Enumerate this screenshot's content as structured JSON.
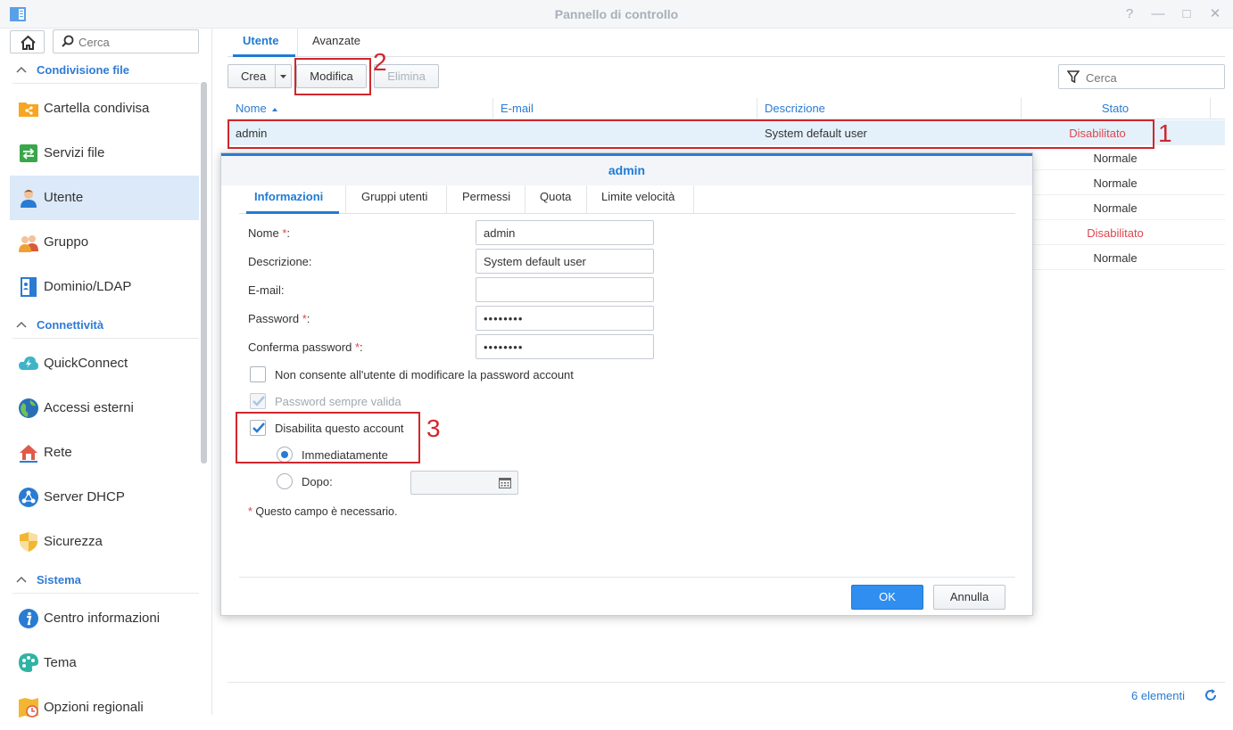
{
  "window": {
    "title": "Pannello di controllo"
  },
  "sidebar": {
    "search_placeholder": "Cerca",
    "sections": [
      {
        "label": "Condivisione file"
      },
      {
        "label": "Connettività"
      },
      {
        "label": "Sistema"
      }
    ],
    "items": [
      {
        "label": "Cartella condivisa",
        "icon": "shared-folder-icon"
      },
      {
        "label": "Servizi file",
        "icon": "file-services-icon"
      },
      {
        "label": "Utente",
        "icon": "user-icon"
      },
      {
        "label": "Gruppo",
        "icon": "group-icon"
      },
      {
        "label": "Dominio/LDAP",
        "icon": "domain-ldap-icon"
      },
      {
        "label": "QuickConnect",
        "icon": "quickconnect-icon"
      },
      {
        "label": "Accessi esterni",
        "icon": "external-access-icon"
      },
      {
        "label": "Rete",
        "icon": "network-icon"
      },
      {
        "label": "Server DHCP",
        "icon": "dhcp-server-icon"
      },
      {
        "label": "Sicurezza",
        "icon": "security-icon"
      },
      {
        "label": "Centro informazioni",
        "icon": "info-center-icon"
      },
      {
        "label": "Tema",
        "icon": "theme-icon"
      },
      {
        "label": "Opzioni regionali",
        "icon": "regional-options-icon"
      }
    ]
  },
  "main": {
    "tabs": [
      {
        "label": "Utente"
      },
      {
        "label": "Avanzate"
      }
    ],
    "toolbar": {
      "create": "Crea",
      "edit": "Modifica",
      "delete": "Elimina",
      "filter_placeholder": "Cerca"
    },
    "columns": [
      "Nome",
      "E-mail",
      "Descrizione",
      "Stato"
    ],
    "rows": [
      {
        "name": "admin",
        "email": "",
        "description": "System default user",
        "status": "Disabilitato"
      },
      {
        "status": "Normale"
      },
      {
        "status": "Normale"
      },
      {
        "status": "Normale"
      },
      {
        "status": "Disabilitato"
      },
      {
        "status": "Normale"
      }
    ],
    "footer": {
      "count": "6 elementi"
    }
  },
  "annotations": [
    "1",
    "2",
    "3"
  ],
  "dialog": {
    "title": "admin",
    "tabs": [
      "Informazioni",
      "Gruppi utenti",
      "Permessi",
      "Quota",
      "Limite velocità"
    ],
    "fields": {
      "name_label": "Nome",
      "name_value": "admin",
      "description_label": "Descrizione:",
      "description_value": "System default user",
      "email_label": "E-mail:",
      "email_value": "",
      "password_label": "Password",
      "password_value": "••••••••",
      "confirm_label": "Conferma password",
      "confirm_value": "••••••••",
      "required_mark": "*",
      "colon": ":"
    },
    "options": {
      "no_change_pw": "Non consente all'utente di modificare la password account",
      "pw_always_valid": "Password sempre valida",
      "disable_account": "Disabilita questo account",
      "immediately": "Immediatamente",
      "after": "Dopo:"
    },
    "required_note": "Questo campo è necessario.",
    "buttons": {
      "ok": "OK",
      "cancel": "Annulla"
    },
    "colors": {
      "accent": "#2a7bd2",
      "danger": "#e0454f",
      "annotation": "#d0272d"
    }
  }
}
